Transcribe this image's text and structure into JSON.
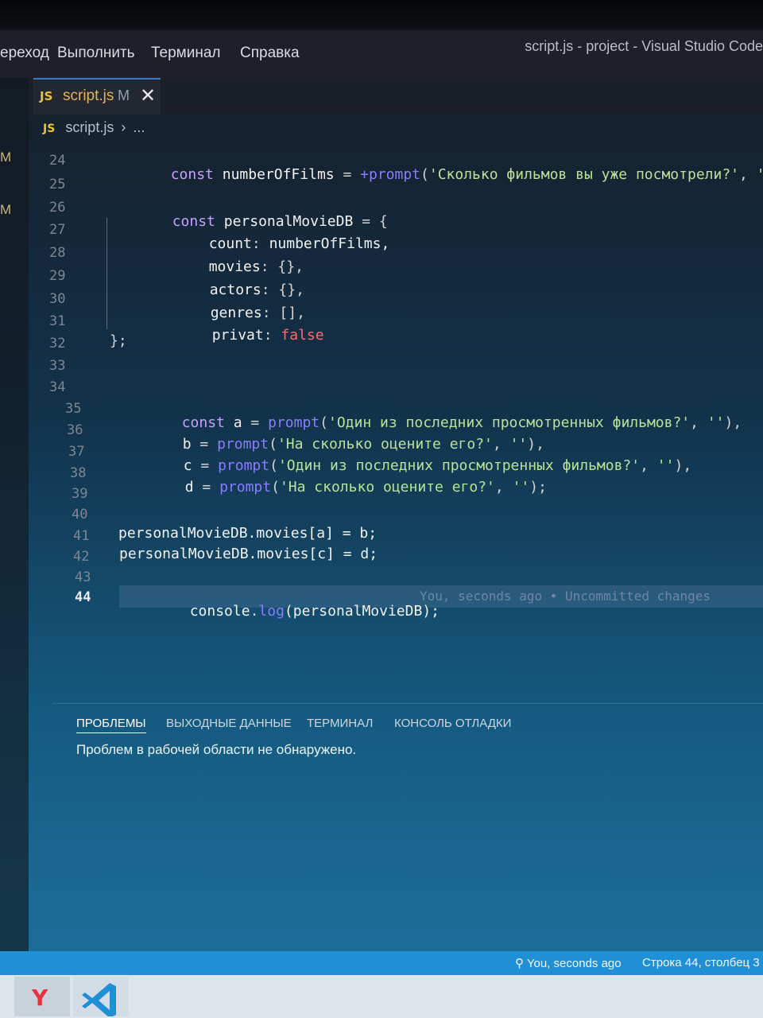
{
  "window": {
    "title": "script.js - project - Visual Studio Code"
  },
  "menu": {
    "items": [
      "ереход",
      "Выполнить",
      "Терминал",
      "Справка"
    ]
  },
  "sidebar": {
    "markers": [
      "M",
      "M"
    ]
  },
  "editor": {
    "tab": {
      "badge": "JS",
      "name": "script.js",
      "status": "M",
      "close": "✕"
    },
    "breadcrumb": {
      "badge": "JS",
      "file": "script.js",
      "sep": "›",
      "more": "..."
    },
    "line_numbers": [
      "24",
      "25",
      "26",
      "27",
      "28",
      "29",
      "30",
      "31",
      "32",
      "33",
      "34",
      "35",
      "36",
      "37",
      "38",
      "39",
      "40",
      "41",
      "42",
      "43",
      "44"
    ],
    "active_line": "44",
    "code": {
      "l24": {
        "kw": "const",
        "name": "numberOfFilms",
        "eq": "=",
        "plus": "+",
        "fn": "prompt",
        "open": "(",
        "str1": "'Сколько фильмов вы уже посмотрели?'",
        "comma": ",",
        "str2": "''",
        "close": ");"
      },
      "l26": {
        "kw": "const",
        "name": "personalMovieDB",
        "rest": "= {"
      },
      "l27": {
        "prop": "count",
        "colon": ":",
        "val": "numberOfFilms,"
      },
      "l28": {
        "prop": "movies",
        "colon": ":",
        "val": "{},"
      },
      "l29": {
        "prop": "actors",
        "colon": ":",
        "val": "{},"
      },
      "l30": {
        "prop": "genres",
        "colon": ":",
        "val": "[],"
      },
      "l31": {
        "prop": "privat",
        "colon": ":",
        "val": "false"
      },
      "l32": {
        "text": "};"
      },
      "l35": {
        "kw": "const",
        "var": "a",
        "eq": "=",
        "fn": "prompt",
        "open": "(",
        "str1": "'Один из последних просмотренных фильмов?'",
        "comma": ",",
        "str2": "''",
        "close": "),"
      },
      "l36": {
        "var": "b",
        "eq": "=",
        "fn": "prompt",
        "open": "(",
        "str1": "'На сколько оцените его?'",
        "comma": ",",
        "str2": "''",
        "close": "),"
      },
      "l37": {
        "var": "c",
        "eq": "=",
        "fn": "prompt",
        "open": "(",
        "str1": "'Один из последних просмотренных фильмов?'",
        "comma": ",",
        "str2": "''",
        "close": "),"
      },
      "l38": {
        "var": "d",
        "eq": "=",
        "fn": "prompt",
        "open": "(",
        "str1": "'На сколько оцените его?'",
        "comma": ",",
        "str2": "''",
        "close": ");"
      },
      "l41": {
        "text": "personalMovieDB.movies[a] = b;"
      },
      "l42": {
        "text": "personalMovieDB.movies[c] = d;"
      },
      "l44": {
        "obj": "console",
        "dot": ".",
        "fn": "log",
        "rest": "(personalMovieDB);"
      }
    },
    "blame": "You, seconds ago • Uncommitted changes"
  },
  "panel": {
    "tabs": [
      "ПРОБЛЕМЫ",
      "ВЫХОДНЫЕ ДАННЫЕ",
      "ТЕРМИНАЛ",
      "КОНСОЛЬ ОТЛАДКИ"
    ],
    "active_tab": "ПРОБЛЕМЫ",
    "message": "Проблем в рабочей области не обнаружено."
  },
  "statusbar": {
    "blame": "You, seconds ago",
    "position": "Строка 44, столбец 3"
  },
  "taskbar": {
    "apps": [
      "yandex-browser-icon",
      "vscode-icon"
    ],
    "yandex_letter": "Y"
  },
  "colors": {
    "statusbar": "#1f8fd6",
    "keyword": "#c8a0ff",
    "function": "#8a7cff",
    "string": "#b9e29a",
    "boolean": "#ff6a6a"
  }
}
